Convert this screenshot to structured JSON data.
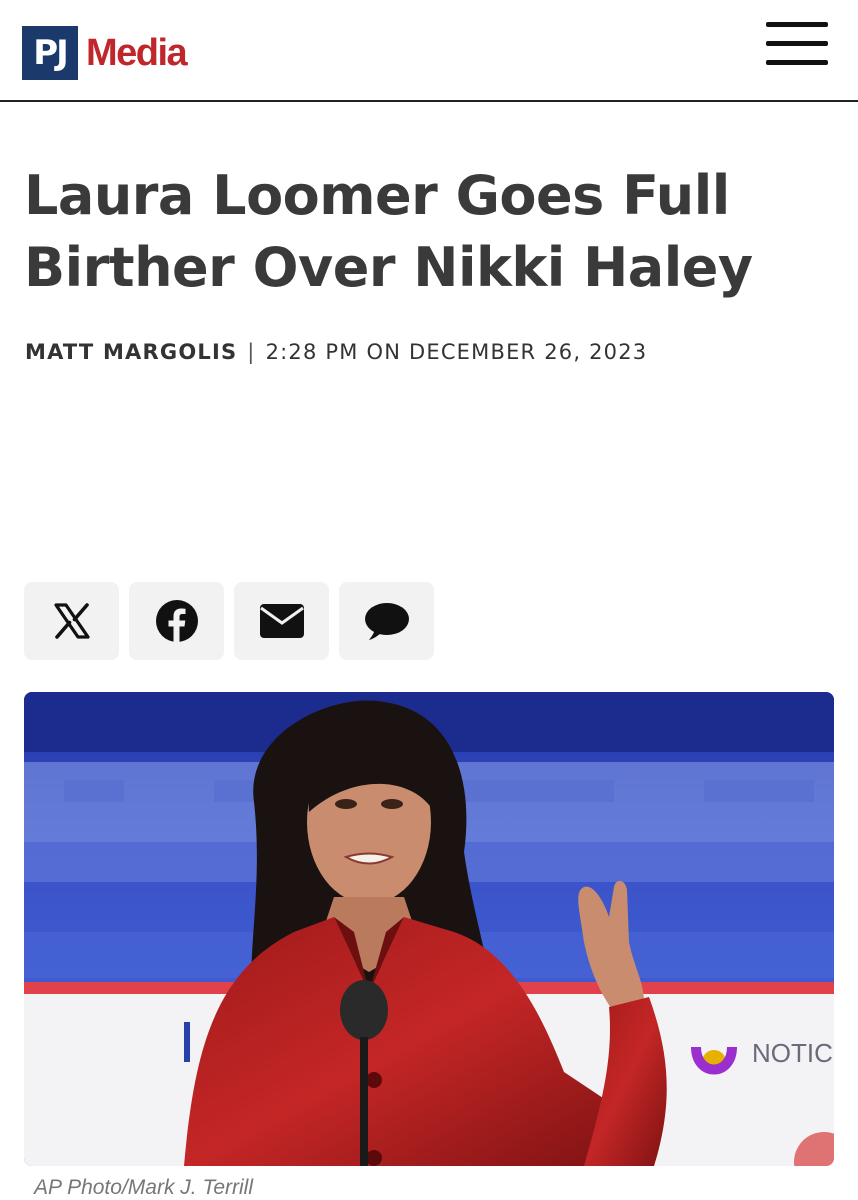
{
  "header": {
    "logo_pj": "PJ",
    "logo_media": "Media",
    "menu_icon": "hamburger-menu-icon"
  },
  "article": {
    "title": "Laura Loomer Goes Full Birther Over Nikki Haley",
    "author": "MATT MARGOLIS",
    "separator": "|",
    "date": "2:28 PM ON DECEMBER 26, 2023"
  },
  "share": {
    "buttons": [
      {
        "icon": "x-twitter-icon"
      },
      {
        "icon": "facebook-icon"
      },
      {
        "icon": "email-icon"
      },
      {
        "icon": "comment-icon"
      }
    ]
  },
  "photo": {
    "caption": "AP Photo/Mark J. Terrill",
    "background_text": "NOTIC UNIV"
  },
  "colors": {
    "brand_blue": "#1b3a6b",
    "brand_red": "#c0272d",
    "title_text": "#3a3a3a",
    "share_bg": "#f2f2f2"
  }
}
